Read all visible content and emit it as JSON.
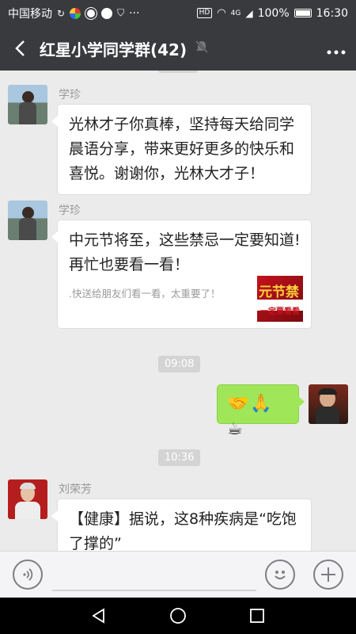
{
  "status_bar": {
    "carrier": "中国移动",
    "dots": "···",
    "hd_badge": "HD",
    "network": "4G",
    "battery_percent": "100%",
    "time": "16:30"
  },
  "header": {
    "title": "红星小学同学群(42)",
    "back_icon": "back-arrow-icon",
    "mute_icon": "bell-mute-icon",
    "more_icon": "more-dots-icon"
  },
  "messages": [
    {
      "sender": "学珍",
      "type": "text",
      "text": "光林才子你真棒，坚持每天给同学晨语分享，带来更好更多的快乐和喜悦。谢谢你，光林大才子！"
    },
    {
      "sender": "学珍",
      "type": "link_card",
      "title": "中元节将至，这些禁忌一定要知道! 再忙也要看一看！",
      "description": ".快送给朋友们看一看，太重要了！",
      "thumb_text_1": "元节禁",
      "thumb_text_2": "一定要看看"
    },
    {
      "type": "timestamp",
      "text": "09:08"
    },
    {
      "sender_side": "self",
      "type": "emoji",
      "emojis": "🤝🙏☕"
    },
    {
      "type": "timestamp",
      "text": "10:36"
    },
    {
      "sender": "刘荣芳",
      "type": "text",
      "text": "【健康】据说，这8种疾病是“吃饱了撑的”"
    }
  ],
  "input_bar": {
    "voice_icon": "voice-icon",
    "emoji_icon": "emoji-face-icon",
    "plus_icon": "plus-icon"
  },
  "nav_bar": {
    "back_icon": "nav-back-triangle-icon",
    "home_icon": "nav-home-circle-icon",
    "recents_icon": "nav-recents-square-icon"
  },
  "colors": {
    "header_bg": "#393a3e",
    "chat_bg": "#ebebeb",
    "self_bubble": "#9fe658",
    "timestamp_bg": "#d4d4d4"
  }
}
